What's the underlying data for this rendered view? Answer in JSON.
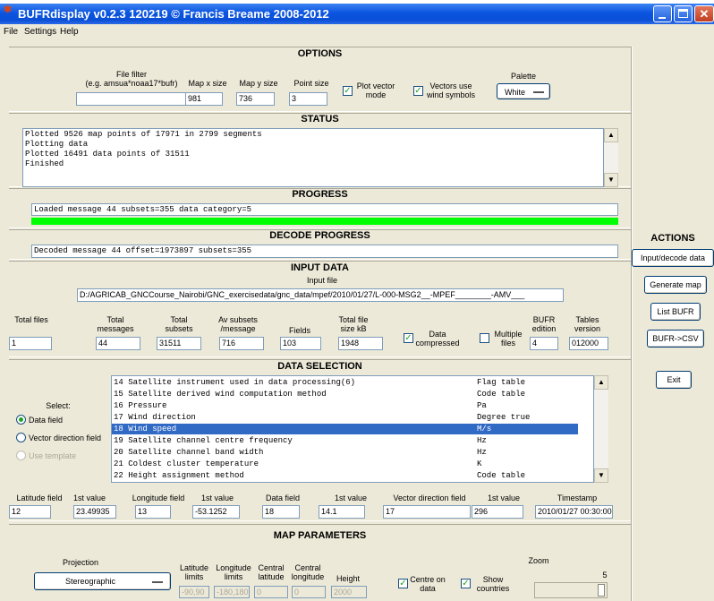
{
  "window": {
    "title": "BUFRdisplay v0.2.3 120219 © Francis Breame 2008-2012",
    "menu": [
      "File",
      "Settings",
      "Help"
    ]
  },
  "options": {
    "title": "OPTIONS",
    "file_filter_label": "File filter",
    "file_filter_hint": "(e.g. amsua*noaa17*bufr)",
    "file_filter_value": "",
    "map_x_label": "Map x size",
    "map_x_value": "981",
    "map_y_label": "Map y size",
    "map_y_value": "736",
    "point_size_label": "Point size",
    "point_size_value": "3",
    "plot_vector_label": "Plot vector mode",
    "plot_vector_checked": true,
    "vectors_wind_label": "Vectors use wind symbols",
    "vectors_wind_checked": true,
    "palette_label": "Palette",
    "palette_value": "White"
  },
  "status": {
    "title": "STATUS",
    "lines": [
      "Plotted 9526 map points of 17971 in 2799 segments",
      "Plotting data",
      "Plotted 16491 data points of 31511",
      "Finished"
    ]
  },
  "progress": {
    "title": "PROGRESS",
    "text": "Loaded message 44 subsets=355 data category=5",
    "fill_fraction": 1.0,
    "color": "#00ff00"
  },
  "decode_progress": {
    "title": "DECODE PROGRESS",
    "text": "Decoded message 44 offset=1973897 subsets=355"
  },
  "input_data": {
    "title": "INPUT DATA",
    "input_file_label": "Input file",
    "input_file_value": "D:/AGRICAB_GNCCourse_Nairobi/GNC_exercisedata/gnc_data/mpef/2010/01/27/L-000-MSG2__-MPEF________-AMV___",
    "total_files_label": "Total files",
    "total_files": "1",
    "total_messages_label": "Total messages",
    "total_messages": "44",
    "total_subsets_label": "Total subsets",
    "total_subsets": "31511",
    "av_subsets_label": "Av subsets /message",
    "av_subsets": "716",
    "fields_label": "Fields",
    "fields": "103",
    "total_size_label": "Total file size kB",
    "total_size": "1948",
    "data_compressed_label": "Data compressed",
    "data_compressed_checked": true,
    "multiple_files_label": "Multiple files",
    "multiple_files_checked": false,
    "bufr_edition_label": "BUFR edition",
    "bufr_edition": "4",
    "tables_version_label": "Tables version",
    "tables_version": "012000"
  },
  "data_selection": {
    "title": "DATA SELECTION",
    "select_label": "Select:",
    "radio_data_field": "Data field",
    "radio_vector_field": "Vector direction field",
    "radio_template": "Use template",
    "selected_radio": "data_field",
    "rows": [
      {
        "name": "14 Satellite instrument used in data processing(6)",
        "unit": "Flag table"
      },
      {
        "name": "15 Satellite derived wind computation method",
        "unit": "Code table"
      },
      {
        "name": "16 Pressure",
        "unit": "Pa"
      },
      {
        "name": "17 Wind direction",
        "unit": "Degree true"
      },
      {
        "name": "18 Wind speed",
        "unit": "M/s"
      },
      {
        "name": "19 Satellite channel centre frequency",
        "unit": "Hz"
      },
      {
        "name": "20 Satellite channel band width",
        "unit": "Hz"
      },
      {
        "name": "21 Coldest cluster temperature",
        "unit": "K"
      },
      {
        "name": "22 Height assignment method",
        "unit": "Code table"
      }
    ],
    "selected_row": 4,
    "lat_field_label": "Latitude field",
    "lat_field": "12",
    "lat_first_label": "1st value",
    "lat_first": "23.49935",
    "lon_field_label": "Longitude field",
    "lon_field": "13",
    "lon_first_label": "1st value",
    "lon_first": "-53.1252",
    "data_field_label": "Data field",
    "data_field": "18",
    "data_first_label": "1st value",
    "data_first": "14.1",
    "vector_field_label": "Vector direction field",
    "vector_field": "17",
    "vector_first_label": "1st value",
    "vector_first": "296",
    "timestamp_label": "Timestamp",
    "timestamp": "2010/01/27 00:30:00"
  },
  "map_parameters": {
    "title": "MAP PARAMETERS",
    "projection_label": "Projection",
    "projection_value": "Stereographic",
    "lat_limits_label": "Latitude limits",
    "lat_limits": "-90,90",
    "lon_limits_label": "Longitude limits",
    "lon_limits": "-180,180",
    "central_lat_label": "Central latitude",
    "central_lat": "0",
    "central_lon_label": "Central longitude",
    "central_lon": "0",
    "height_label": "Height",
    "height": "2000",
    "centre_on_data_label": "Centre on data",
    "centre_on_data_checked": true,
    "show_countries_label": "Show countries",
    "show_countries_checked": true,
    "zoom_label": "Zoom",
    "zoom_value": "5"
  },
  "actions": {
    "title": "ACTIONS",
    "input_decode": "Input/decode data",
    "generate_map": "Generate map",
    "list_bufr": "List BUFR",
    "bufr_csv": "BUFR->CSV",
    "exit": "Exit"
  }
}
